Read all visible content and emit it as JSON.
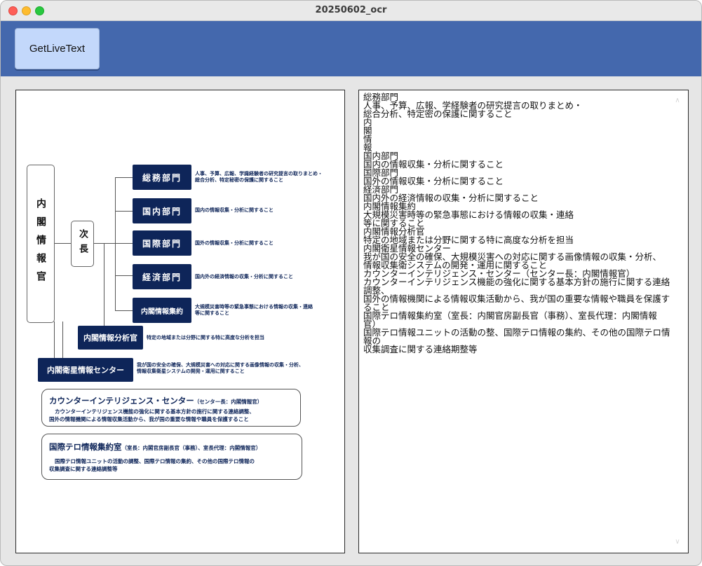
{
  "window": {
    "title": "20250602_ocr"
  },
  "toolbar": {
    "button_label": "GetLiveText"
  },
  "org": {
    "cabinet": "内閣情報官",
    "deputy": "次長",
    "departments": [
      {
        "name": "総務部門",
        "desc1": "人事、予算、広報、学識経験者の研究提言の取りまとめ・",
        "desc2": "総合分析、特定秘密の保護に関すること"
      },
      {
        "name": "国内部門",
        "desc1": "国内の情報収集・分析に関すること",
        "desc2": ""
      },
      {
        "name": "国際部門",
        "desc1": "国外の情報収集・分析に関すること",
        "desc2": ""
      },
      {
        "name": "経済部門",
        "desc1": "国内外の経済情報の収集・分析に関すること",
        "desc2": ""
      },
      {
        "name": "内閣情報集約",
        "desc1": "大規模災害時等の緊急事態における情報の収集・連絡",
        "desc2": "等に関すること"
      }
    ],
    "analyst": {
      "name": "内閣情報分析官",
      "desc": "特定の地域または分野に関する特に高度な分析を担当"
    },
    "satellite": {
      "name": "内閣衛星情報センター",
      "desc1": "我が国の安全の確保、大規模災害への対応に関する画像情報の収集・分析、",
      "desc2": "情報収集衛星システムの開発・運用に関すること"
    },
    "counter_intel": {
      "title": "カウンターインテリジェンス・センター",
      "sub": "（センター長：内閣情報官）",
      "desc1": "カウンターインテリジェンス機能の強化に関する基本方針の施行に関する連絡調整、",
      "desc2": "国外の情報機関による情報収集活動から、我が国の重要な情報や職員を保護すること"
    },
    "terror": {
      "title": "国際テロ情報集約室",
      "sub": "（室長：内閣官房副長官（事務）、室長代理：内閣情報官）",
      "desc1": "国際テロ情報ユニットの活動の調整、国際テロ情報の集約、その他の国際テロ情報の",
      "desc2": "収集調査に関する連絡調整等"
    }
  },
  "ocr_lines": [
    "総務部門",
    "人事、予算、広報、学経験者の研究提言の取りまとめ・",
    "総合分析、特定密の保護に関すること",
    "内",
    "閣",
    "情",
    "報",
    "国内部門",
    "国内の情報収集・分析に関すること",
    "国際部門",
    "国外の情報収集・分析に関すること",
    "経済部門",
    "国内外の経済情報の収集・分析に関すること",
    "内閣情報集約",
    "大規模災害時等の緊急事態における情報の収集・連絡",
    "等に関すること",
    "内閣情報分析官",
    "特定の地域または分野に関する特に高度な分析を担当",
    "内閣衛星情報センター",
    "我が国の安全の確保、大規模災害への対応に関する画像情報の収集・分析、",
    "情報収集衛システムの開発・運用に関すること",
    "カウンターインテリジェンス・センター（センター長：内閣情報官）",
    "カウンターインテリジェンス機能の強化に関する基本方針の施行に関する連絡",
    "調整、",
    "国外の情報機関による情報収集活動から、我が国の重要な情報や職員を保護す",
    "ること",
    "国際テロ情報集約室（室長：内閣官房副長官（事務）、室長代理：内閣情報",
    "官）",
    "国際テロ情報ユニットの活動の整、国際テロ情報の集約、その他の国際テロ情",
    "報の",
    "収集調査に関する連絡期整等"
  ]
}
